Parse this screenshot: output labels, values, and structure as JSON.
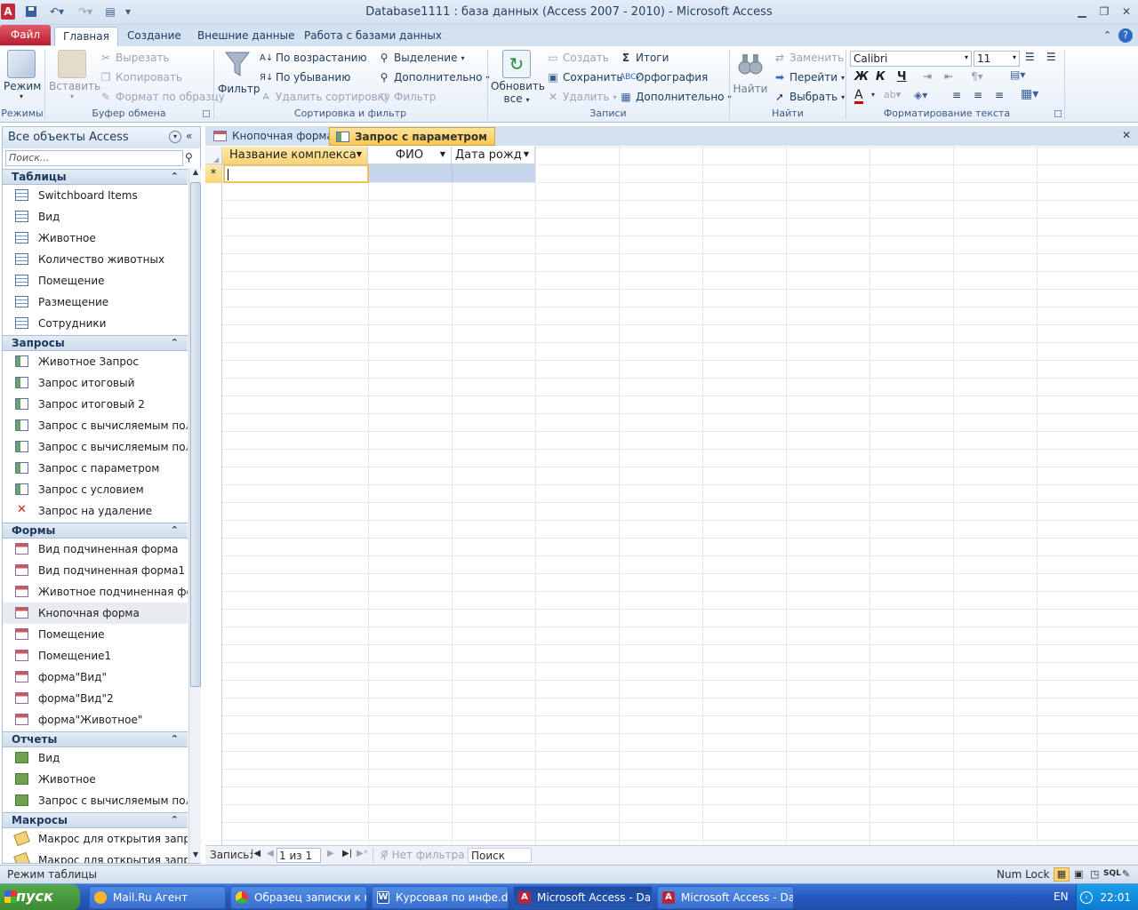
{
  "window": {
    "title": "Database1111 : база данных (Access 2007 - 2010)  -  Microsoft Access",
    "app_icon": "A"
  },
  "ribbon_tabs": [
    "Файл",
    "Главная",
    "Создание",
    "Внешние данные",
    "Работа с базами данных"
  ],
  "ribbon": {
    "views": {
      "mode": "Режим",
      "label": "Режимы"
    },
    "clipboard": {
      "paste": "Вставить",
      "cut": "Вырезать",
      "copy": "Копировать",
      "format_painter": "Формат по образцу",
      "label": "Буфер обмена"
    },
    "sort_filter": {
      "filter": "Фильтр",
      "ascending": "По возрастанию",
      "descending": "По убыванию",
      "remove_sort": "Удалить сортировку",
      "selection": "Выделение",
      "advanced": "Дополнительно",
      "toggle_filter": "Фильтр",
      "label": "Сортировка и фильтр"
    },
    "records": {
      "refresh_l1": "Обновить",
      "refresh_l2": "все",
      "new": "Создать",
      "save": "Сохранить",
      "delete": "Удалить",
      "totals": "Итоги",
      "spelling": "Орфография",
      "more": "Дополнительно",
      "label": "Записи"
    },
    "find": {
      "find": "Найти",
      "replace": "Заменить",
      "goto": "Перейти",
      "select": "Выбрать",
      "label": "Найти"
    },
    "text_format": {
      "font": "Calibri",
      "size": "11",
      "bold": "Ж",
      "italic": "К",
      "underline": "Ч",
      "font_color_glyph": "A",
      "label": "Форматирование текста"
    }
  },
  "nav": {
    "title": "Все объекты Access",
    "search_placeholder": "Поиск...",
    "groups": {
      "tables": {
        "label": "Таблицы",
        "items": [
          "Switchboard Items",
          "Вид",
          "Животное",
          "Количество животных",
          "Помещение",
          "Размещение",
          "Сотрудники"
        ]
      },
      "queries": {
        "label": "Запросы",
        "items": [
          "Животное Запрос",
          "Запрос итоговый",
          "Запрос итоговый 2",
          "Запрос с вычисляемым полем",
          "Запрос с вычисляемым пол...",
          "Запрос с параметром",
          "Запрос с условием",
          "Запрос на удаление"
        ]
      },
      "forms": {
        "label": "Формы",
        "items": [
          "Вид подчиненная форма",
          "Вид подчиненная форма1",
          "Животное подчиненная фо...",
          "Кнопочная форма",
          "Помещение",
          "Помещение1",
          "форма\"Вид\"",
          "форма\"Вид\"2",
          "форма\"Животное\""
        ]
      },
      "reports": {
        "label": "Отчеты",
        "items": [
          "Вид",
          "Животное",
          "Запрос с вычисляемым полем"
        ]
      },
      "macros": {
        "label": "Макросы",
        "items": [
          "Макрос для открытия запро...",
          "Макрос для открытия запро..."
        ]
      }
    }
  },
  "doc_tabs": [
    "Кнопочная форма",
    "Запрос с параметром"
  ],
  "datasheet": {
    "columns": [
      "Название комплекса",
      "ФИО",
      "Дата рожде"
    ],
    "new_row_marker": "*"
  },
  "record_nav": {
    "label": "Запись:",
    "current": "1 из 1",
    "filter": "Нет фильтра",
    "search": "Поиск"
  },
  "status": {
    "left": "Режим таблицы",
    "numlock": "Num Lock",
    "sql": "SQL"
  },
  "taskbar": {
    "start": "пуск",
    "tasks": [
      "Mail.Ru Агент",
      "Образец записки к к...",
      "Курсовая по инфе.d...",
      "Microsoft Access - Da...",
      "Microsoft Access - Da..."
    ],
    "lang": "EN",
    "clock": "22:01"
  }
}
